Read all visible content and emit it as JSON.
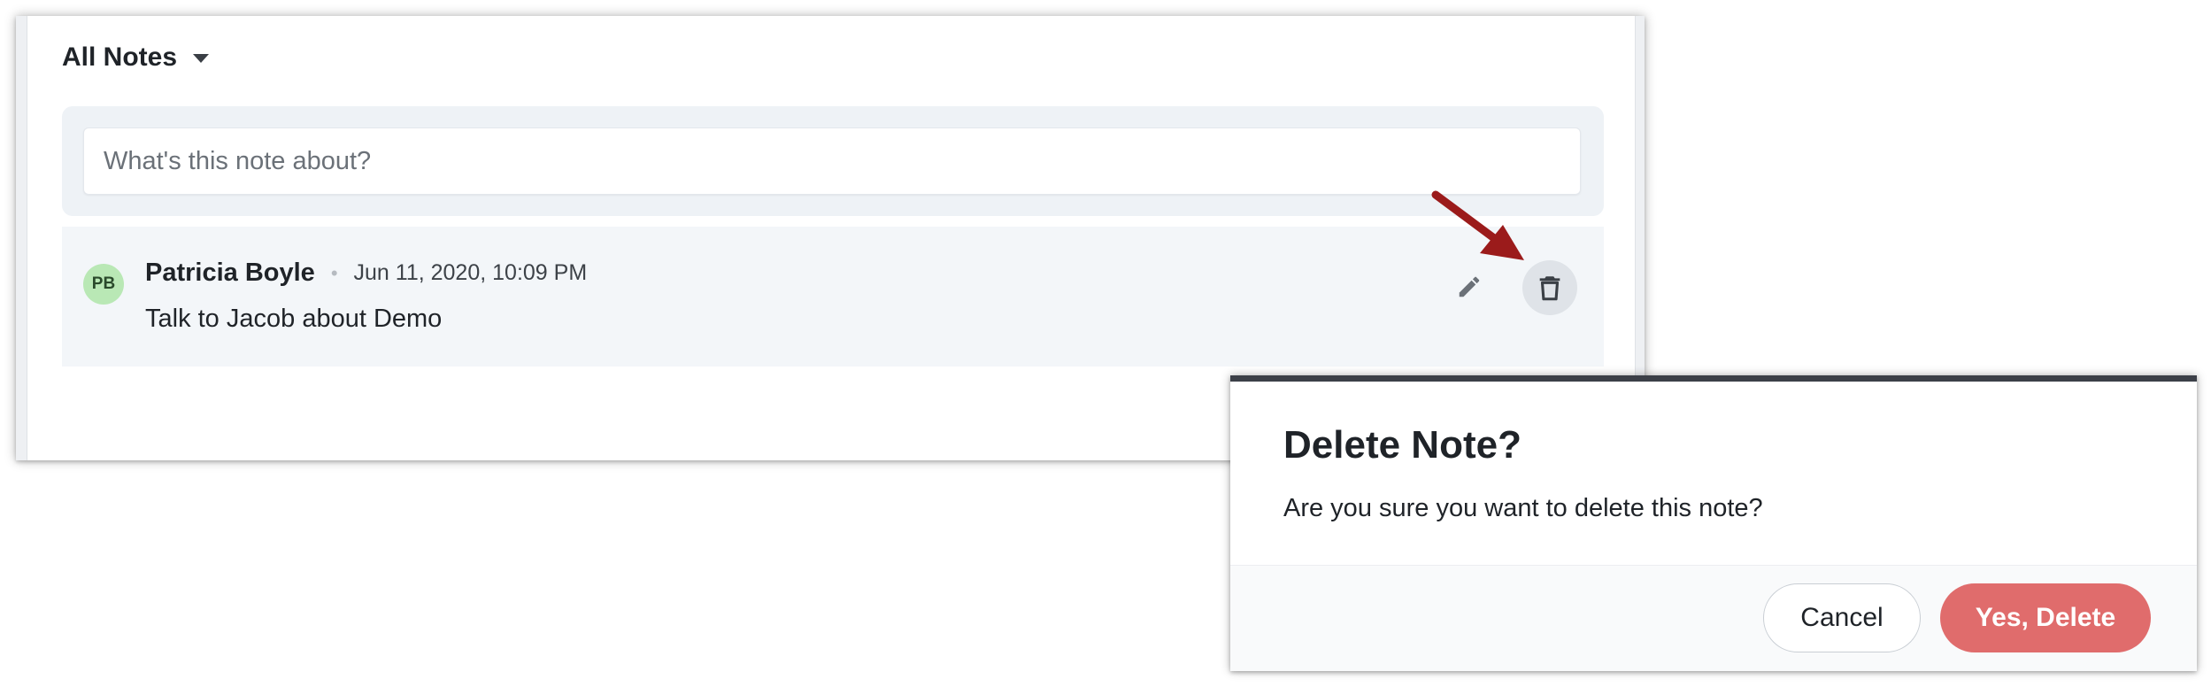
{
  "notes": {
    "filter_label": "All Notes",
    "composer_placeholder": "What's this note about?",
    "items": [
      {
        "avatar_initials": "PB",
        "author": "Patricia Boyle",
        "separator": "•",
        "timestamp": "Jun 11, 2020, 10:09 PM",
        "text": "Talk to Jacob about Demo"
      }
    ]
  },
  "dialog": {
    "title": "Delete Note?",
    "message": "Are you sure you want to delete this note?",
    "cancel_label": "Cancel",
    "confirm_label": "Yes, Delete"
  },
  "icons": {
    "filter_dropdown": "caret-down-icon",
    "edit": "pencil-icon",
    "delete": "trash-icon",
    "callout": "arrow-icon"
  },
  "colors": {
    "avatar_bg": "#b9e8b5",
    "danger": "#e06c6c",
    "callout_arrow": "#9b1b1b",
    "dialog_accent": "#3c4048"
  }
}
